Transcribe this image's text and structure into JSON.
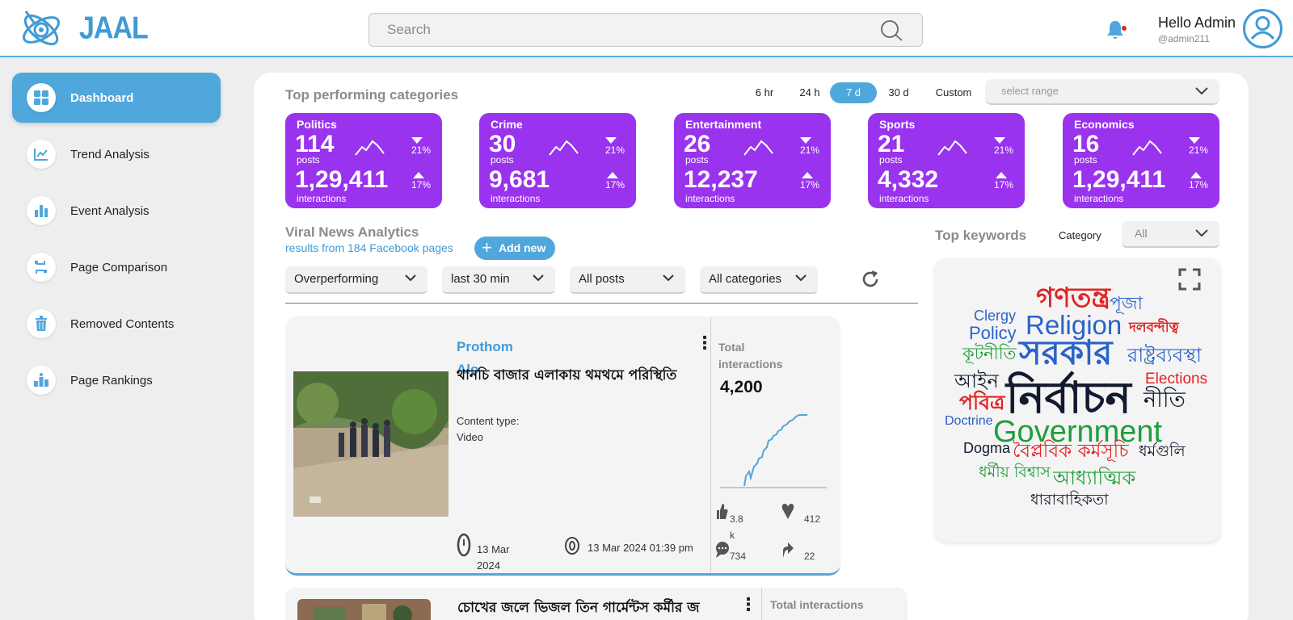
{
  "header": {
    "logo_text": "JAAL",
    "search_placeholder": "Search",
    "greeting": "Hello Admin",
    "handle": "@admin211"
  },
  "sidebar": {
    "items": [
      {
        "label": "Dashboard",
        "icon": "grid-icon",
        "active": true
      },
      {
        "label": "Trend Analysis",
        "icon": "line-chart-icon"
      },
      {
        "label": "Event Analysis",
        "icon": "bar-chart-icon"
      },
      {
        "label": "Page Comparison",
        "icon": "compare-icon"
      },
      {
        "label": "Removed Contents",
        "icon": "trash-icon"
      },
      {
        "label": "Page Rankings",
        "icon": "ranking-icon"
      }
    ]
  },
  "top_categories": {
    "title": "Top performing categories",
    "ranges": [
      "6 hr",
      "24 h",
      "7 d",
      "30 d",
      "Custom"
    ],
    "active_range": "7 d",
    "range_placeholder": "select range",
    "cards": [
      {
        "name": "Politics",
        "posts": "114",
        "posts_label": "posts",
        "interactions": "1,29,411",
        "interactions_label": "interactions",
        "down_pct": "21%",
        "up_pct": "17%"
      },
      {
        "name": "Crime",
        "posts": "30",
        "posts_label": "posts",
        "interactions": "9,681",
        "interactions_label": "interactions",
        "down_pct": "21%",
        "up_pct": "17%"
      },
      {
        "name": "Entertainment",
        "posts": "26",
        "posts_label": "posts",
        "interactions": "12,237",
        "interactions_label": "interactions",
        "down_pct": "21%",
        "up_pct": "17%"
      },
      {
        "name": "Sports",
        "posts": "21",
        "posts_label": "posts",
        "interactions": "4,332",
        "interactions_label": "interactions",
        "down_pct": "21%",
        "up_pct": "17%"
      },
      {
        "name": "Economics",
        "posts": "16",
        "posts_label": "posts",
        "interactions": "1,29,411",
        "interactions_label": "interactions",
        "down_pct": "21%",
        "up_pct": "17%"
      }
    ]
  },
  "viral": {
    "title": "Viral News Analytics",
    "subtitle": "results from 184 Facebook pages",
    "add_button": "Add new",
    "filters": [
      "Overperforming",
      "last 30 min",
      "All posts",
      "All categories"
    ],
    "posts": [
      {
        "source": "Prothom Alo",
        "headline": "থানচি বাজার এলাকায় থমথমে পরিস্থিতি",
        "content_type_label": "Content type:",
        "content_type": "Video",
        "date": "13 Mar 2024",
        "datetime": "13 Mar 2024 01:39 pm",
        "total_label": "Total interactions",
        "total": "4,200",
        "likes": "3.8k",
        "loves": "412",
        "comments": "734",
        "shares": "22"
      },
      {
        "headline": "চোখের জলে ভিজল তিন গার্মেন্টস কর্মীর জ",
        "total_label": "Total interactions"
      }
    ]
  },
  "keywords": {
    "title": "Top keywords",
    "category_label": "Category",
    "category_value": "All",
    "words": [
      {
        "text": "গণতন্ত্র",
        "color": "#e02424"
      },
      {
        "text": "পূজা",
        "color": "#2a63c9"
      },
      {
        "text": "Clergy",
        "color": "#2a63c9"
      },
      {
        "text": "Religion",
        "color": "#2a63c9"
      },
      {
        "text": "দলবন্দীত্ব",
        "color": "#e02424"
      },
      {
        "text": "Policy",
        "color": "#2a63c9"
      },
      {
        "text": "কূটনীতি",
        "color": "#1e9e3a"
      },
      {
        "text": "সরকার",
        "color": "#2a63c9"
      },
      {
        "text": "রাষ্ট্রব্যবস্থা",
        "color": "#2a63c9"
      },
      {
        "text": "আইন",
        "color": "#111a2e"
      },
      {
        "text": "Elections",
        "color": "#e02424"
      },
      {
        "text": "পবিত্র",
        "color": "#e02424"
      },
      {
        "text": "নির্বাচন",
        "color": "#111a2e"
      },
      {
        "text": "নীতি",
        "color": "#111a2e"
      },
      {
        "text": "Doctrine",
        "color": "#2a63c9"
      },
      {
        "text": "Government",
        "color": "#1e9e3a"
      },
      {
        "text": "Dogma",
        "color": "#111a2e"
      },
      {
        "text": "বৈপ্লবিক কর্মসূচি",
        "color": "#e02424"
      },
      {
        "text": "ধর্মগুলি",
        "color": "#111a2e"
      },
      {
        "text": "ধর্মীয় বিশ্বাস",
        "color": "#1e9e3a"
      },
      {
        "text": "আধ্যাত্মিক",
        "color": "#1e9e3a"
      },
      {
        "text": "ধারাবাহিকতা",
        "color": "#111a2e"
      }
    ]
  },
  "colors": {
    "accent": "#4fa7dc",
    "card": "#9933ee"
  }
}
